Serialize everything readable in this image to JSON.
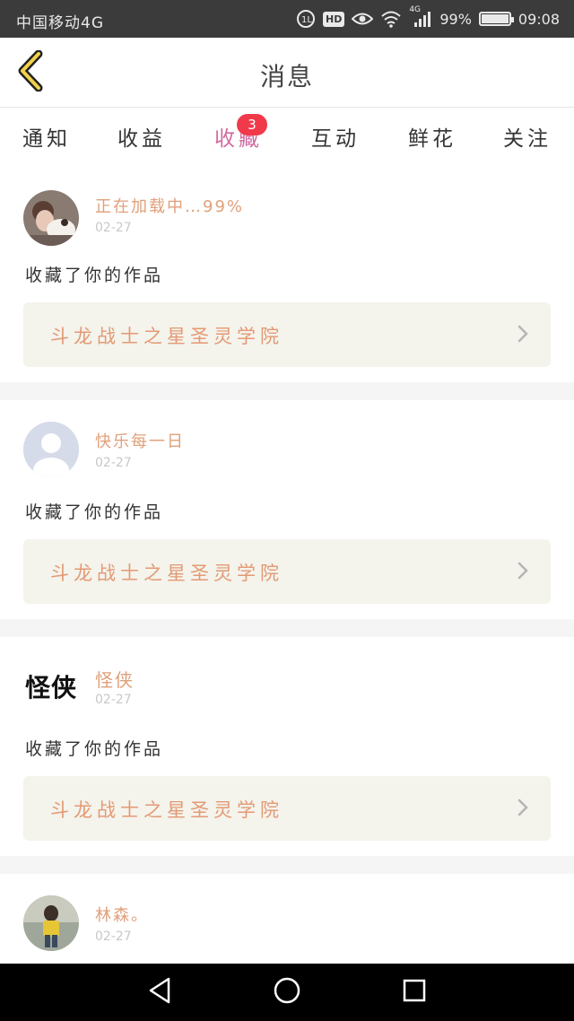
{
  "status_bar": {
    "carrier": "中国移动4G",
    "hd": "HD",
    "network": "4G",
    "battery_text": "99%",
    "battery_level": 0.99,
    "time": "09:08"
  },
  "header": {
    "title": "消息",
    "back_icon": "chevron-left-icon"
  },
  "tabs": [
    {
      "label": "通知",
      "active": false
    },
    {
      "label": "收益",
      "active": false
    },
    {
      "label": "收藏",
      "active": true,
      "badge": "3"
    },
    {
      "label": "互动",
      "active": false
    },
    {
      "label": "鲜花",
      "active": false
    },
    {
      "label": "关注",
      "active": false
    }
  ],
  "messages": [
    {
      "user": "正在加载中…99%",
      "date": "02-27",
      "action": "收藏了你的作品",
      "work": "斗龙战士之星圣灵学院"
    },
    {
      "user": "快乐每一日",
      "date": "02-27",
      "action": "收藏了你的作品",
      "work": "斗龙战士之星圣灵学院"
    },
    {
      "user": "怪侠",
      "avatar_text": "怪侠",
      "date": "02-27",
      "action": "收藏了你的作品",
      "work": "斗龙战士之星圣灵学院"
    },
    {
      "user": "林森。",
      "date": "02-27"
    }
  ],
  "colors": {
    "accent_pink": "#d06aa0",
    "badge_red": "#f03a4a",
    "username_orange": "#e0a07a",
    "work_bg": "#f4f3ec"
  },
  "navbar": {
    "back": "triangle-back-icon",
    "home": "circle-home-icon",
    "recents": "square-recents-icon"
  }
}
